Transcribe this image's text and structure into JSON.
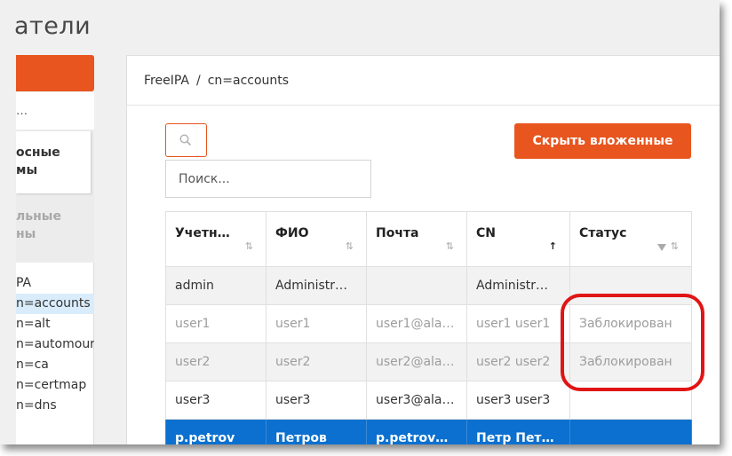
{
  "page": {
    "title": "атели"
  },
  "sidebar": {
    "ellipsis": "…",
    "tab_active": "осные\nмы",
    "tab_inactive": "льные\nны",
    "tree": [
      {
        "label": "PA",
        "selected": false
      },
      {
        "label": "n=accounts",
        "selected": true
      },
      {
        "label": "n=alt",
        "selected": false
      },
      {
        "label": "n=automour",
        "selected": false
      },
      {
        "label": "n=ca",
        "selected": false
      },
      {
        "label": "n=certmap",
        "selected": false
      },
      {
        "label": "n=dns",
        "selected": false
      }
    ]
  },
  "breadcrumb": {
    "root": "FreeIPA",
    "separator": "/",
    "current": "cn=accounts"
  },
  "search": {
    "placeholder": "Поиск...",
    "value": ""
  },
  "toolbar": {
    "hide_nested_label": "Скрыть вложенные"
  },
  "table": {
    "columns": [
      {
        "label": "Учетн…",
        "sort": "both",
        "filter": false
      },
      {
        "label": "ФИО",
        "sort": "both",
        "filter": false
      },
      {
        "label": "Почта",
        "sort": "both",
        "filter": false
      },
      {
        "label": "CN",
        "sort": "asc",
        "filter": false
      },
      {
        "label": "Статус",
        "sort": "both",
        "filter": true
      }
    ],
    "rows": [
      {
        "style": "shade",
        "cells": [
          "admin",
          "Administr…",
          "",
          "Administr…",
          ""
        ]
      },
      {
        "style": "locked",
        "cells": [
          "user1",
          "user1",
          "user1@ala…",
          "user1 user1",
          "Заблокирован"
        ]
      },
      {
        "style": "locked alt",
        "cells": [
          "user2",
          "user2",
          "user2@ala…",
          "user2 user2",
          "Заблокирован"
        ]
      },
      {
        "style": "normal",
        "cells": [
          "user3",
          "user3",
          "user3@ala…",
          "user3 user3",
          ""
        ]
      },
      {
        "style": "selected",
        "cells": [
          "p.petrov",
          "Петров",
          "p.petrov@…",
          "Петр Петр…",
          ""
        ]
      }
    ]
  },
  "colors": {
    "accent": "#e8551f",
    "selection": "#0b70cf",
    "highlight": "#e01515"
  }
}
